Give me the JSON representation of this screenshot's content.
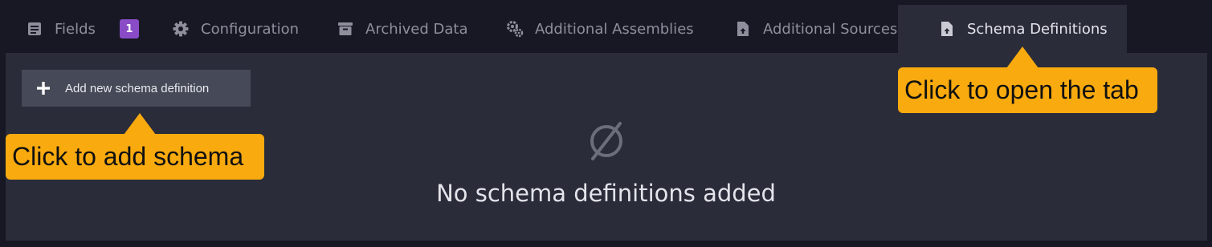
{
  "tabs": [
    {
      "label": "Fields",
      "icon": "list-icon",
      "badge": "1"
    },
    {
      "label": "Configuration",
      "icon": "gear-icon"
    },
    {
      "label": "Archived Data",
      "icon": "archive-icon"
    },
    {
      "label": "Additional Assemblies",
      "icon": "gears-icon"
    },
    {
      "label": "Additional Sources",
      "icon": "file-upload-icon"
    },
    {
      "label": "Schema Definitions",
      "icon": "file-upload-icon",
      "active": true
    }
  ],
  "toolbar": {
    "add_label": "Add new schema definition"
  },
  "empty_state": {
    "icon": "empty-set-icon",
    "message": "No schema definitions added"
  },
  "annotations": {
    "add_schema": "Click to add schema",
    "open_tab": "Click to open the tab"
  },
  "colors": {
    "background": "#181824",
    "panel": "#2a2c3a",
    "button": "#464957",
    "badge": "#8a4bc7",
    "callout": "#f9aa0e"
  }
}
